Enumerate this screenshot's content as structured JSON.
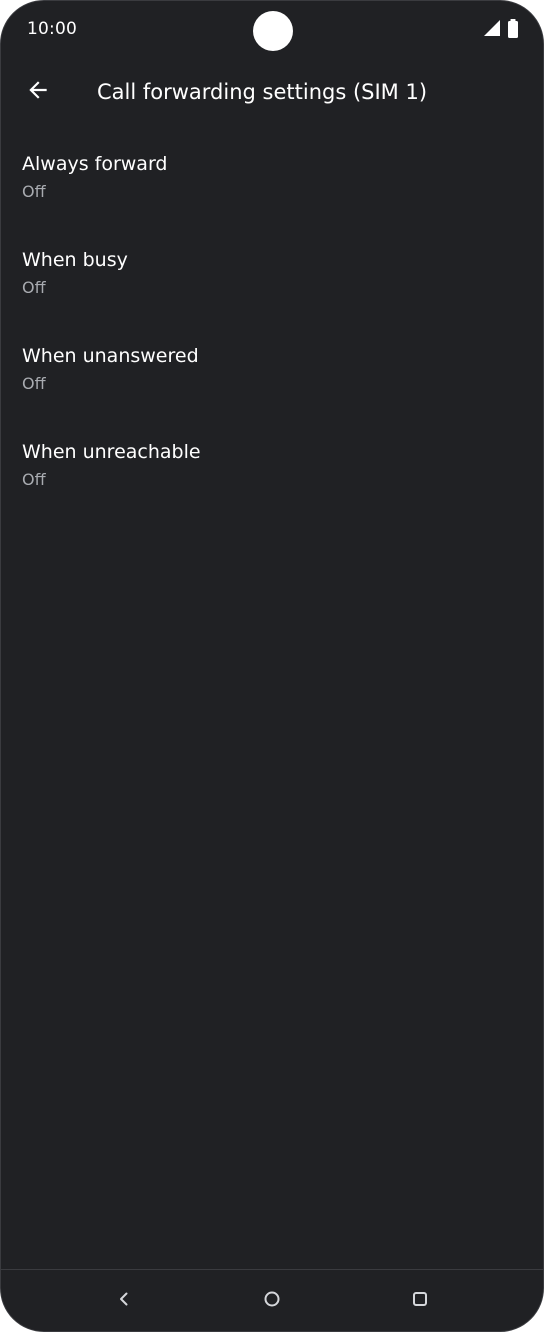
{
  "status_bar": {
    "time": "10:00",
    "icons": [
      "signal-icon",
      "battery-icon"
    ]
  },
  "app_bar": {
    "back_icon": "arrow-back-icon",
    "title": "Call forwarding settings (SIM 1)"
  },
  "settings": {
    "items": [
      {
        "title": "Always forward",
        "summary": "Off"
      },
      {
        "title": "When busy",
        "summary": "Off"
      },
      {
        "title": "When unanswered",
        "summary": "Off"
      },
      {
        "title": "When unreachable",
        "summary": "Off"
      }
    ]
  },
  "nav_bar": {
    "icons": [
      "nav-back-icon",
      "nav-home-icon",
      "nav-recents-icon"
    ]
  },
  "colors": {
    "background": "#202124",
    "text_primary": "#ffffff",
    "text_secondary": "#a8abb0",
    "nav_icon": "#d5d7db"
  }
}
